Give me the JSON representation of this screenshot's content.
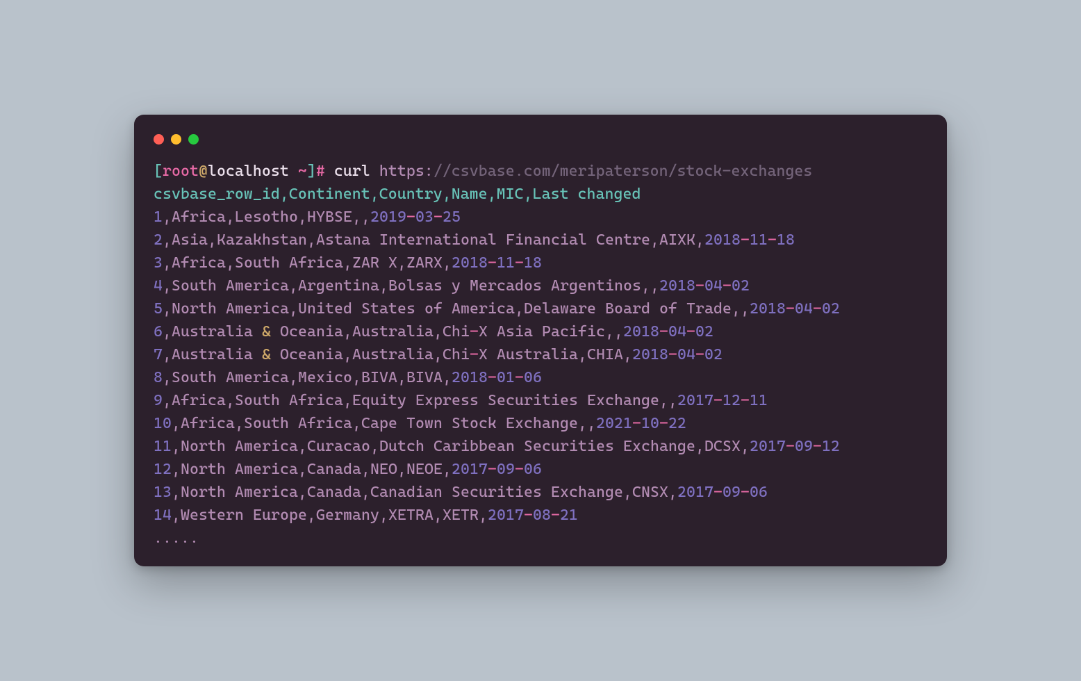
{
  "prompt": {
    "user": "root",
    "at": "@",
    "host": "localhost",
    "tilde": "~",
    "hash": "#",
    "cmd": "curl",
    "scheme": "https:",
    "url_rest": "//csvbase.com/meripaterson/stock-exchanges"
  },
  "header": "csvbase_row_id,Continent,Country,Name,MIC,Last changed",
  "rows": [
    {
      "id": "1",
      "cont": "Africa",
      "country": "Lesotho",
      "name": "HYBSE",
      "mic": "",
      "y": "2019",
      "m": "03",
      "d": "25"
    },
    {
      "id": "2",
      "cont": "Asia",
      "country": "Kazakhstan",
      "name": "Astana International Financial Centre",
      "mic": "AIXK",
      "y": "2018",
      "m": "11",
      "d": "18"
    },
    {
      "id": "3",
      "cont": "Africa",
      "country": "South Africa",
      "name": "ZAR X",
      "mic": "ZARX",
      "y": "2018",
      "m": "11",
      "d": "18"
    },
    {
      "id": "4",
      "cont": "South America",
      "country": "Argentina",
      "name": "Bolsas y Mercados Argentinos",
      "mic": "",
      "y": "2018",
      "m": "04",
      "d": "02"
    },
    {
      "id": "5",
      "cont": "North America",
      "country": "United States of America",
      "name": "Delaware Board of Trade",
      "mic": "",
      "y": "2018",
      "m": "04",
      "d": "02"
    },
    {
      "id": "6",
      "cont": "Australia & Oceania",
      "country": "Australia",
      "name": "Chi-X Asia Pacific",
      "mic": "",
      "y": "2018",
      "m": "04",
      "d": "02"
    },
    {
      "id": "7",
      "cont": "Australia & Oceania",
      "country": "Australia",
      "name": "Chi-X Australia",
      "mic": "CHIA",
      "y": "2018",
      "m": "04",
      "d": "02"
    },
    {
      "id": "8",
      "cont": "South America",
      "country": "Mexico",
      "name": "BIVA",
      "mic": "BIVA",
      "y": "2018",
      "m": "01",
      "d": "06"
    },
    {
      "id": "9",
      "cont": "Africa",
      "country": "South Africa",
      "name": "Equity Express Securities Exchange",
      "mic": "",
      "y": "2017",
      "m": "12",
      "d": "11"
    },
    {
      "id": "10",
      "cont": "Africa",
      "country": "South Africa",
      "name": "Cape Town Stock Exchange",
      "mic": "",
      "y": "2021",
      "m": "10",
      "d": "22"
    },
    {
      "id": "11",
      "cont": "North America",
      "country": "Curacao",
      "name": "Dutch Caribbean Securities Exchange",
      "mic": "DCSX",
      "y": "2017",
      "m": "09",
      "d": "12"
    },
    {
      "id": "12",
      "cont": "North America",
      "country": "Canada",
      "name": "NEO",
      "mic": "NEOE",
      "y": "2017",
      "m": "09",
      "d": "06"
    },
    {
      "id": "13",
      "cont": "North America",
      "country": "Canada",
      "name": "Canadian Securities Exchange",
      "mic": "CNSX",
      "y": "2017",
      "m": "09",
      "d": "06"
    },
    {
      "id": "14",
      "cont": "Western Europe",
      "country": "Germany",
      "name": "XETRA",
      "mic": "XETR",
      "y": "2017",
      "m": "08",
      "d": "21"
    }
  ],
  "ellipsis": "....."
}
